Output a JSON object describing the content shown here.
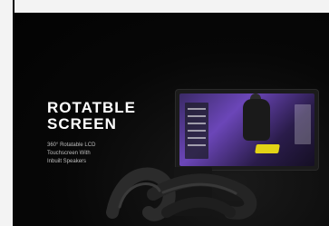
{
  "headline": "ROTATBLE\nSCREEN",
  "subcopy": "360° Rotatable LCD\nTouchscreen With\nInbuilt Speakers",
  "colors": {
    "background": "#050505",
    "headline": "#ffffff",
    "subcopy": "#bdbdbd",
    "screen_accent": "#6b46b8",
    "bike_accent": "#e3d316"
  },
  "icons": {
    "monitor": "rotatable-touchscreen-icon",
    "handlebar": "bike-handlebar-icon"
  }
}
